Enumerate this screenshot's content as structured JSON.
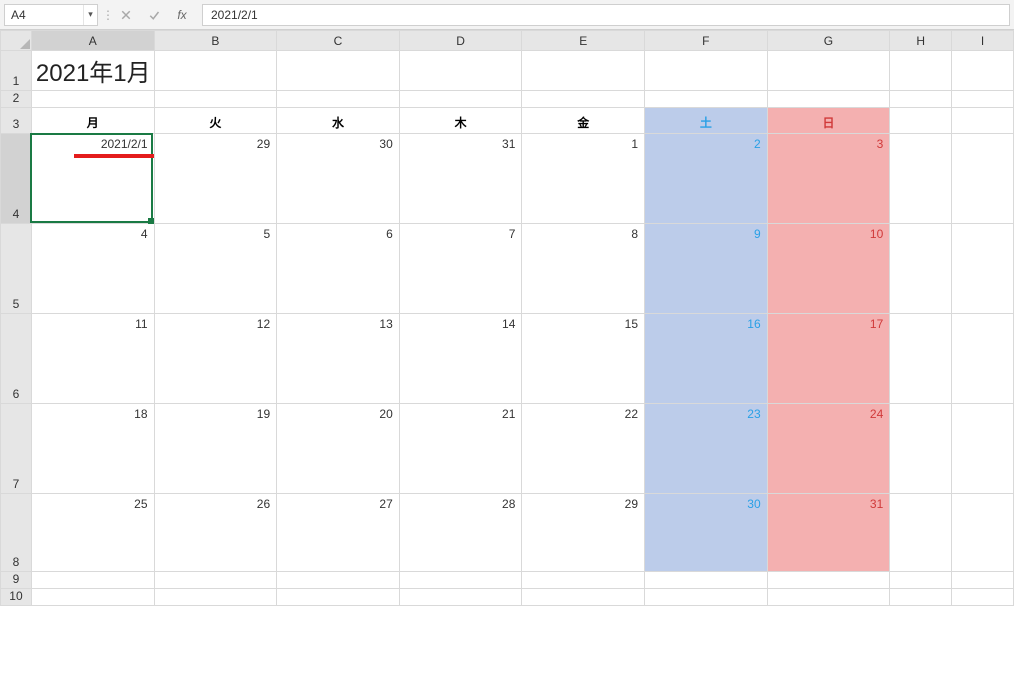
{
  "formula_bar": {
    "cell_ref": "A4",
    "formula_value": "2021/2/1"
  },
  "columns": [
    "A",
    "B",
    "C",
    "D",
    "E",
    "F",
    "G",
    "H",
    "I"
  ],
  "rows": [
    "1",
    "2",
    "3",
    "4",
    "5",
    "6",
    "7",
    "8",
    "9",
    "10"
  ],
  "selected_cell": "A4",
  "sheet": {
    "title": "2021年1月",
    "dow": [
      "月",
      "火",
      "水",
      "木",
      "金",
      "土",
      "日"
    ],
    "weeks": [
      [
        "2021/2/1",
        "29",
        "30",
        "31",
        "1",
        "2",
        "3"
      ],
      [
        "4",
        "5",
        "6",
        "7",
        "8",
        "9",
        "10"
      ],
      [
        "11",
        "12",
        "13",
        "14",
        "15",
        "16",
        "17"
      ],
      [
        "18",
        "19",
        "20",
        "21",
        "22",
        "23",
        "24"
      ],
      [
        "25",
        "26",
        "27",
        "28",
        "29",
        "30",
        "31"
      ]
    ]
  },
  "chart_data": {
    "type": "table",
    "title": "2021年1月",
    "columns": [
      "月",
      "火",
      "水",
      "木",
      "金",
      "土",
      "日"
    ],
    "rows": [
      [
        "2021/2/1",
        "29",
        "30",
        "31",
        "1",
        "2",
        "3"
      ],
      [
        "4",
        "5",
        "6",
        "7",
        "8",
        "9",
        "10"
      ],
      [
        "11",
        "12",
        "13",
        "14",
        "15",
        "16",
        "17"
      ],
      [
        "18",
        "19",
        "20",
        "21",
        "22",
        "23",
        "24"
      ],
      [
        "25",
        "26",
        "27",
        "28",
        "29",
        "30",
        "31"
      ]
    ],
    "note": "Excel monthly calendar; Saturday column tinted blue, Sunday column tinted red. Cell A4 displays 2021/2/1 and is selected."
  },
  "colors": {
    "saturday_bg": "#bcccea",
    "saturday_fg": "#2aa0e6",
    "sunday_bg": "#f4b0b0",
    "sunday_fg": "#d03a3a",
    "selection": "#1a7a44",
    "annotation_red": "#e41c1c"
  }
}
